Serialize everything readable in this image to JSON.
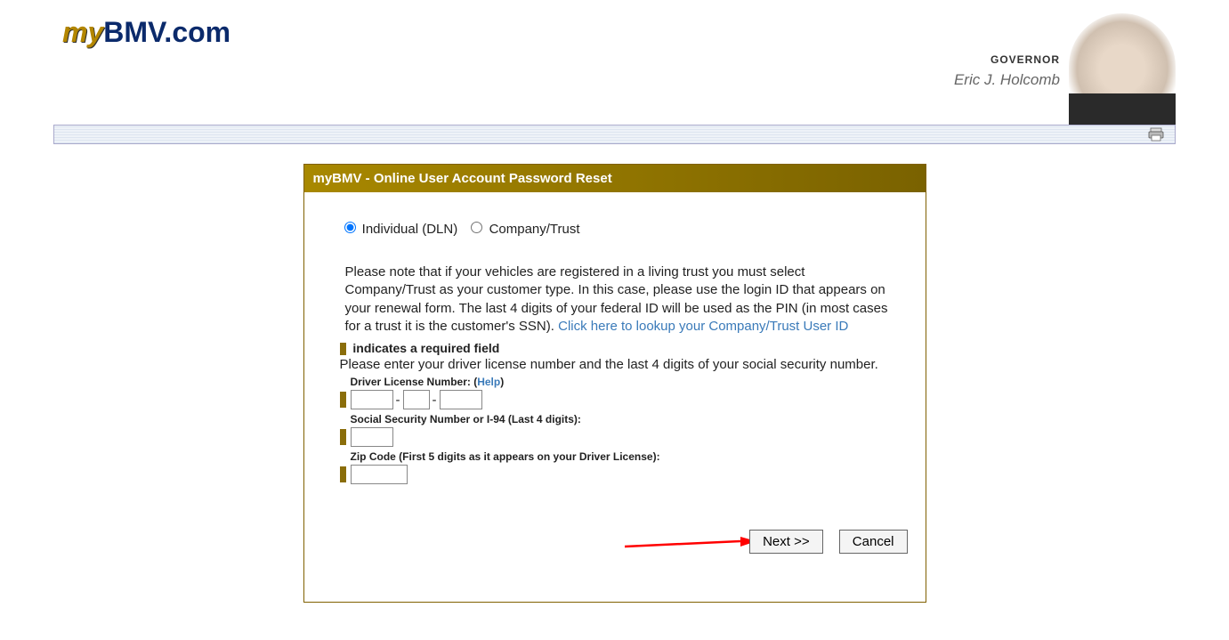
{
  "logo": {
    "my": "my",
    "rest": "BMV.com"
  },
  "governor": {
    "title": "GOVERNOR",
    "name": "Eric J. Holcomb"
  },
  "card": {
    "title": "myBMV - Online User Account Password Reset",
    "radio_individual": "Individual (DLN)",
    "radio_company": "Company/Trust",
    "note": "Please note that if your vehicles are registered in a living trust you must select Company/Trust as your customer type. In this case, please use the login ID that appears on your renewal form. The last 4 digits of your federal ID will be used as the PIN (in most cases for a trust it is the customer's SSN).   ",
    "note_link": "Click here to lookup your Company/Trust User ID",
    "required_text": "indicates a required field",
    "instruction": "Please enter your driver license number and the last 4 digits of your social security number.",
    "dln_label_pre": "Driver License Number: (",
    "dln_help": "Help",
    "dln_label_post": ")",
    "ssn_label": "Social Security Number or I-94 (Last 4 digits):",
    "zip_label": "Zip Code (First 5 digits as it appears on your Driver License):",
    "next_btn": "Next >>",
    "cancel_btn": "Cancel"
  }
}
